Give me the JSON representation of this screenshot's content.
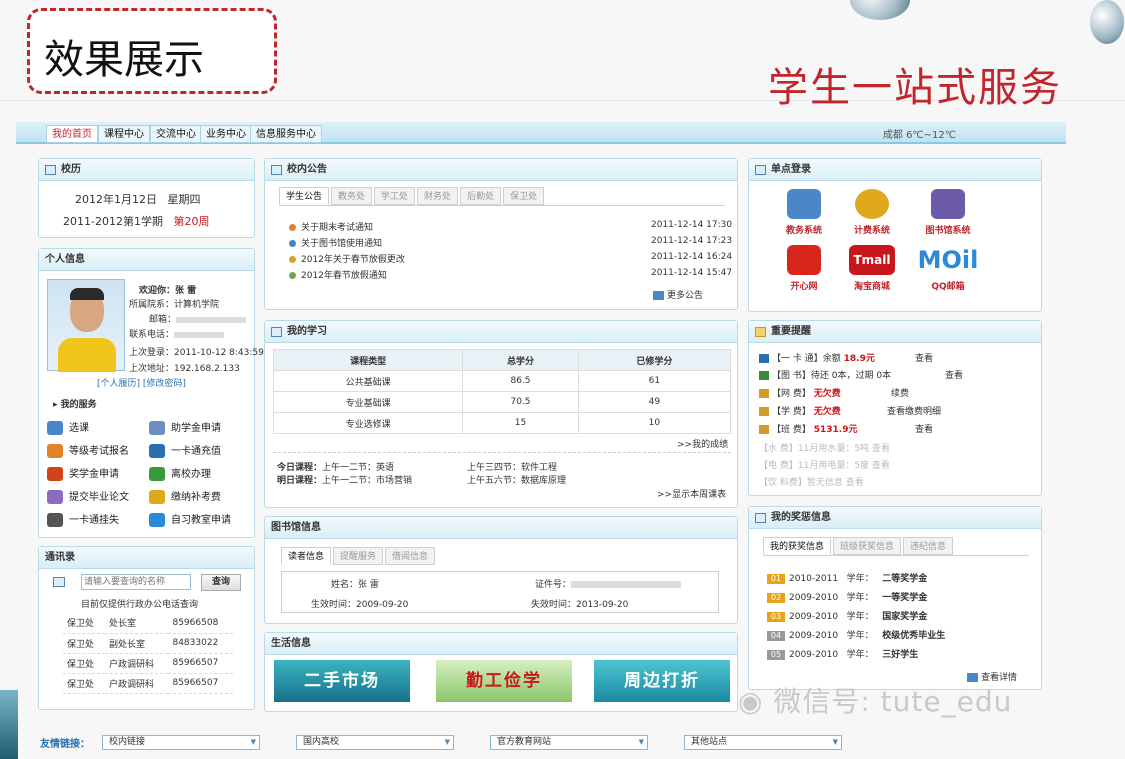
{
  "slide": {
    "title": "效果展示",
    "subtitle": "学生一站式服务"
  },
  "nav": {
    "tabs": [
      "我的首页",
      "课程中心",
      "交流中心",
      "业务中心",
      "信息服务中心"
    ],
    "weather": "成都  6℃~12℃"
  },
  "calendar": {
    "title": "校历",
    "date": "2012年1月12日",
    "weekday": "星期四",
    "term": "2011-2012第1学期",
    "week": "第20周"
  },
  "profile": {
    "title": "个人信息",
    "welcome": "欢迎你：张 雷",
    "dept": "所属院系：计算机学院",
    "email": "邮箱：",
    "phone": "联系电话：",
    "last_login": "上次登录：2011-10-12 8:43:59",
    "last_ip": "上次地址：192.168.2.133",
    "links": "[个人履历] [修改密码]"
  },
  "services": {
    "title": "我的服务",
    "items": [
      "选课",
      "助学金申请",
      "等级考试报名",
      "一卡通充值",
      "奖学金申请",
      "离校办理",
      "提交毕业论文",
      "缴纳补考费",
      "一卡通挂失",
      "自习教室申请"
    ]
  },
  "directory": {
    "title": "通讯录",
    "placeholder": "请输入要查询的名称",
    "button": "查询",
    "note": "目前仅提供行政办公电话查询",
    "rows": [
      [
        "保卫处",
        "处长室",
        "85966508"
      ],
      [
        "保卫处",
        "副处长室",
        "84833022"
      ],
      [
        "保卫处",
        "户政调研科",
        "85966507"
      ],
      [
        "保卫处",
        "户政调研科",
        "85966507"
      ]
    ]
  },
  "notices": {
    "title": "校内公告",
    "tabs": [
      "学生公告",
      "教务处",
      "学工处",
      "财务处",
      "后勤处",
      "保卫处"
    ],
    "items": [
      {
        "text": "关于期末考试通知",
        "time": "2011-12-14 17:30",
        "color": "#e0832a"
      },
      {
        "text": "关于图书馆使用通知",
        "time": "2011-12-14 17:23",
        "color": "#3a86c8"
      },
      {
        "text": "2012年关于春节放假更改",
        "time": "2011-12-14 16:24",
        "color": "#d9a021"
      },
      {
        "text": "2012年春节放假通知",
        "time": "2011-12-14 15:47",
        "color": "#6aa84f"
      }
    ],
    "more": "更多公告"
  },
  "study": {
    "title": "我的学习",
    "headers": [
      "课程类型",
      "总学分",
      "已修学分"
    ],
    "rows": [
      [
        "公共基础课",
        "86.5",
        "61"
      ],
      [
        "专业基础课",
        "70.5",
        "49"
      ],
      [
        "专业选修课",
        "15",
        "10"
      ]
    ],
    "grades_link": ">>我的成绩",
    "today_label": "今日课程：",
    "today_1": "上午一二节：英语",
    "today_2": "上午三四节：软件工程",
    "tomorrow_label": "明日课程：",
    "tomorrow_1": "上午一二节：市场营销",
    "tomorrow_2": "上午五六节：数据库原理",
    "week_link": ">>显示本周课表"
  },
  "library": {
    "title": "图书馆信息",
    "tabs": [
      "读者信息",
      "提醒服务",
      "借阅信息"
    ],
    "name": "姓名：张 雷",
    "cert": "证件号：",
    "start": "生效时间：2009-09-20",
    "end": "失效时间：2013-09-20"
  },
  "life": {
    "title": "生活信息",
    "banners": [
      "二手市场",
      "勤工俭学",
      "周边打折"
    ]
  },
  "sso": {
    "title": "单点登录",
    "items": [
      {
        "label": "教务系统",
        "color": "#4a86c8"
      },
      {
        "label": "计费系统",
        "color": "#e0a81c"
      },
      {
        "label": "图书馆系统",
        "color": "#6b5ba8"
      },
      {
        "label": "开心网",
        "color": "#d9261c"
      },
      {
        "label": "淘宝商城",
        "color": "#c8161e"
      },
      {
        "label": "QQ邮箱",
        "color": "#2a8ad8"
      }
    ]
  },
  "reminders": {
    "title": "重要提醒",
    "items": [
      {
        "k": "【一 卡 通】",
        "t": "余额",
        "v": "18.9元",
        "a": "查看"
      },
      {
        "k": "【图    书】",
        "t": "待还 0本，过期 0本",
        "v": "",
        "a": "查看"
      },
      {
        "k": "【网    费】",
        "t": "",
        "v": "无欠费",
        "a": "续费"
      },
      {
        "k": "【学    费】",
        "t": "",
        "v": "无欠费",
        "a": "查看缴费明细"
      },
      {
        "k": "【班    费】",
        "t": "",
        "v": "5131.9元",
        "a": "查看"
      }
    ],
    "muted": [
      "【水    费】11月用水量：5吨      查看",
      "【电    费】11月用电量：5度      查看",
      "【饮 料费】暂无信息      查看"
    ]
  },
  "awards": {
    "title": "我的奖惩信息",
    "tabs": [
      "我的获奖信息",
      "班级获奖信息",
      "违纪信息"
    ],
    "items": [
      [
        "01",
        "2010-2011",
        "学年：",
        "二等奖学金"
      ],
      [
        "02",
        "2009-2010",
        "学年：",
        "一等奖学金"
      ],
      [
        "03",
        "2009-2010",
        "学年：",
        "国家奖学金"
      ],
      [
        "04",
        "2009-2010",
        "学年：",
        "校级优秀毕业生"
      ],
      [
        "05",
        "2009-2010",
        "学年：",
        "三好学生"
      ]
    ],
    "more": "查看详情"
  },
  "footer": {
    "label": "友情链接：",
    "selects": [
      "校内链接",
      "国内高校",
      "官方教育网站",
      "其他站点"
    ]
  },
  "watermark": "微信号: tute_edu"
}
